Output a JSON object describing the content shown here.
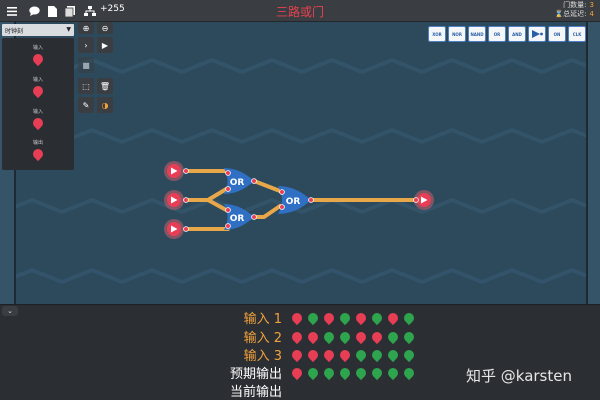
{
  "topbar": {
    "menu_icon": "hamburger-icon",
    "chat_icon": "chat-bubble-icon",
    "doc_icon": "document-icon",
    "copy_icon": "copy-icon",
    "tree_icon": "network-tree-icon",
    "coins": "+255",
    "title": "三路或门",
    "gate_count_label": "门数量:",
    "gate_count": "3",
    "delay_label": "总延迟:",
    "delay": "4"
  },
  "sidebar": {
    "dropdown_value": "时钟刻",
    "pins": [
      {
        "label": "输入"
      },
      {
        "label": "输入"
      },
      {
        "label": "输入"
      },
      {
        "label": "输出"
      }
    ]
  },
  "tools": {
    "zoom_in": "⊕",
    "zoom_out": "⊖",
    "step": "›",
    "play": "▶",
    "stop": "■",
    "select": "⬚",
    "delete": "🗑",
    "pencil": "✎",
    "color": "◑"
  },
  "palette": [
    "XOR",
    "NOR",
    "NAND",
    "OR",
    "AND",
    "",
    "ON",
    "CLK"
  ],
  "circuit": {
    "gates": [
      {
        "label": "OR"
      },
      {
        "label": "OR"
      },
      {
        "label": "OR"
      }
    ]
  },
  "truth_table": {
    "rows": [
      {
        "label": "输入 1",
        "values": [
          0,
          1,
          0,
          1,
          0,
          1,
          0,
          1
        ]
      },
      {
        "label": "输入 2",
        "values": [
          0,
          0,
          1,
          1,
          0,
          0,
          1,
          1
        ]
      },
      {
        "label": "输入 3",
        "values": [
          0,
          0,
          0,
          0,
          1,
          1,
          1,
          1
        ]
      },
      {
        "label": "预期输出",
        "values": [
          0,
          1,
          1,
          1,
          1,
          1,
          1,
          1
        ]
      },
      {
        "label": "当前输出",
        "values": []
      }
    ]
  },
  "colors": {
    "on": "#2fa44f",
    "off": "#e83e55",
    "wire": "#e8a84a",
    "gate": "#2f6fc4",
    "accent": "#f2a13b"
  },
  "watermark": "知乎 @karsten"
}
